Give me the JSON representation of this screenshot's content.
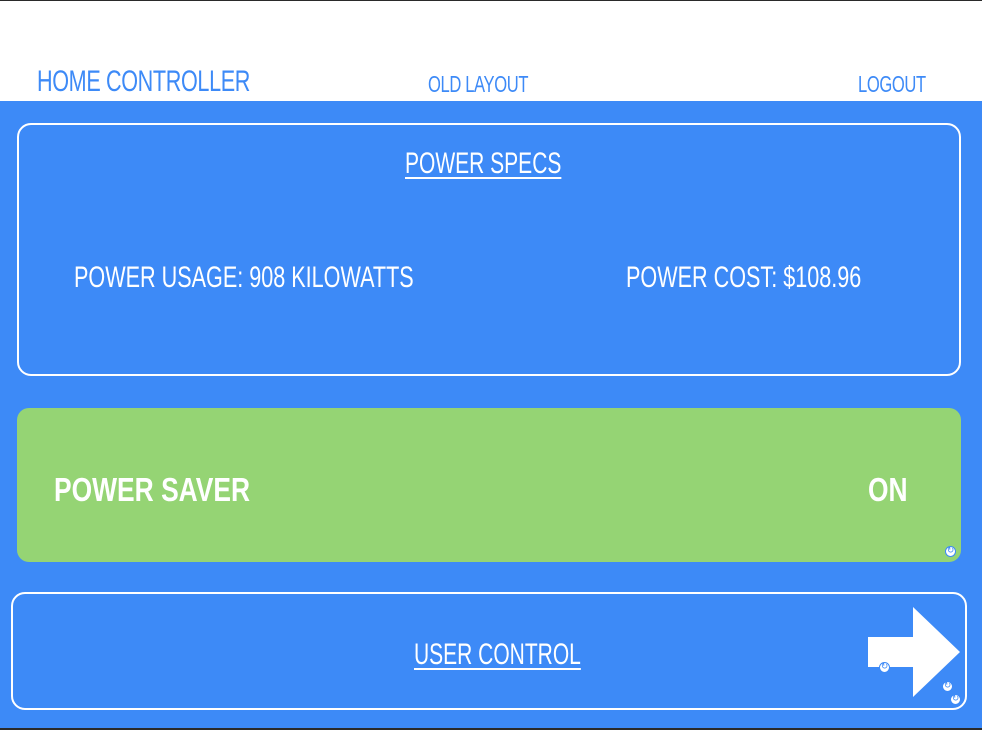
{
  "header": {
    "title": "HOME CONTROLLER",
    "old_layout": "OLD LAYOUT",
    "logout": "LOGOUT"
  },
  "power_specs": {
    "title": "POWER SPECS",
    "usage": "POWER USAGE: 908 KILOWATTS",
    "cost": "POWER COST: $108.96"
  },
  "power_saver": {
    "label": "POWER SAVER",
    "state": "ON"
  },
  "user_control": {
    "label": "USER CONTROL"
  },
  "colors": {
    "background": "#3d8af7",
    "header": "#ffffff",
    "accent_text": "#3d8af7",
    "saver_on": "#95d474"
  },
  "icons": {
    "refresh": "refresh-icon",
    "arrow": "arrow-right-icon"
  }
}
